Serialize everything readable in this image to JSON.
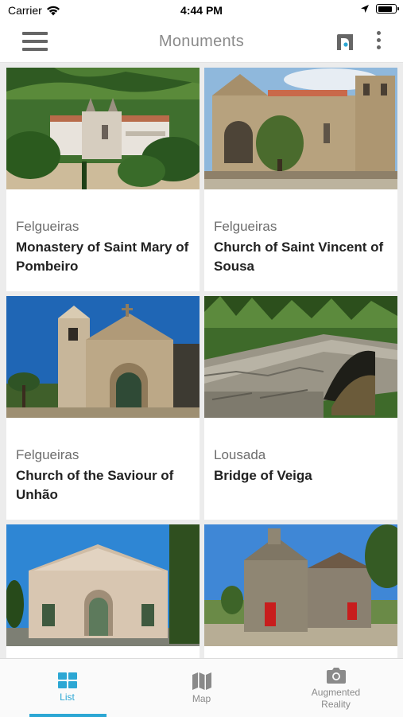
{
  "status_bar": {
    "carrier": "Carrier",
    "time": "4:44 PM",
    "icons": [
      "wifi-icon",
      "location-arrow-icon",
      "battery-icon"
    ],
    "battery_level": 0.85
  },
  "nav": {
    "title": "Monuments",
    "icons": [
      "menu-icon",
      "app-logo-icon",
      "more-options-icon"
    ]
  },
  "monuments": [
    {
      "city": "Felgueiras",
      "name": "Monastery of Saint Mary of Pombeiro"
    },
    {
      "city": "Felgueiras",
      "name": "Church of Saint Vincent of Sousa"
    },
    {
      "city": "Felgueiras",
      "name": "Church of the Saviour of Unhão"
    },
    {
      "city": "Lousada",
      "name": "Bridge of Veiga"
    },
    {
      "city": "",
      "name": ""
    },
    {
      "city": "",
      "name": ""
    }
  ],
  "tabs": [
    {
      "label": "List",
      "icon": "grid-list-icon",
      "active": true
    },
    {
      "label": "Map",
      "icon": "map-icon",
      "active": false
    },
    {
      "label": "Augmented Reality",
      "icon": "camera-icon",
      "active": false
    }
  ],
  "colors": {
    "accent": "#2ca7d4",
    "grid_background": "#ececec",
    "title_grey": "#8a8a8a"
  }
}
